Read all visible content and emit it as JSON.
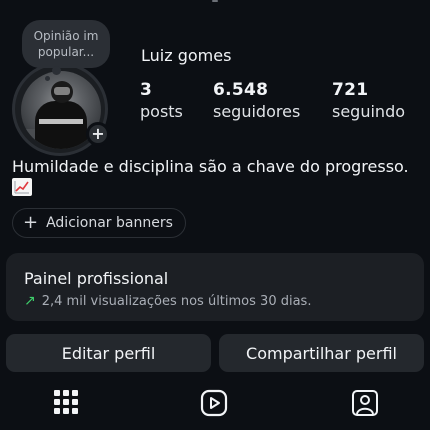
{
  "profile": {
    "note": "Opinião im popular...",
    "username": "Luiz gomes",
    "avatar_icon": "profile-photo",
    "add_icon": "plus-icon"
  },
  "stats": {
    "posts_count": "3",
    "posts_label": "posts",
    "followers_count": "6.548",
    "followers_label": "seguidores",
    "following_count": "721",
    "following_label": "seguindo"
  },
  "bio": {
    "text": "Humildade e disciplina são a chave do progresso.",
    "emoji_icon": "chart-increasing-icon"
  },
  "banner": {
    "label": "Adicionar banners",
    "icon": "plus-icon"
  },
  "professional_panel": {
    "title": "Painel profissional",
    "subtitle": "2,4 mil visualizações nos últimos 30 dias.",
    "trend_icon": "trend-up-arrow-icon",
    "trend_color": "#3ecf6b"
  },
  "actions": {
    "edit_label": "Editar perfil",
    "share_label": "Compartilhar perfil"
  },
  "tabs": [
    {
      "icon": "grid-icon",
      "active": true
    },
    {
      "icon": "reels-icon",
      "active": false
    },
    {
      "icon": "tagged-icon",
      "active": false
    }
  ]
}
